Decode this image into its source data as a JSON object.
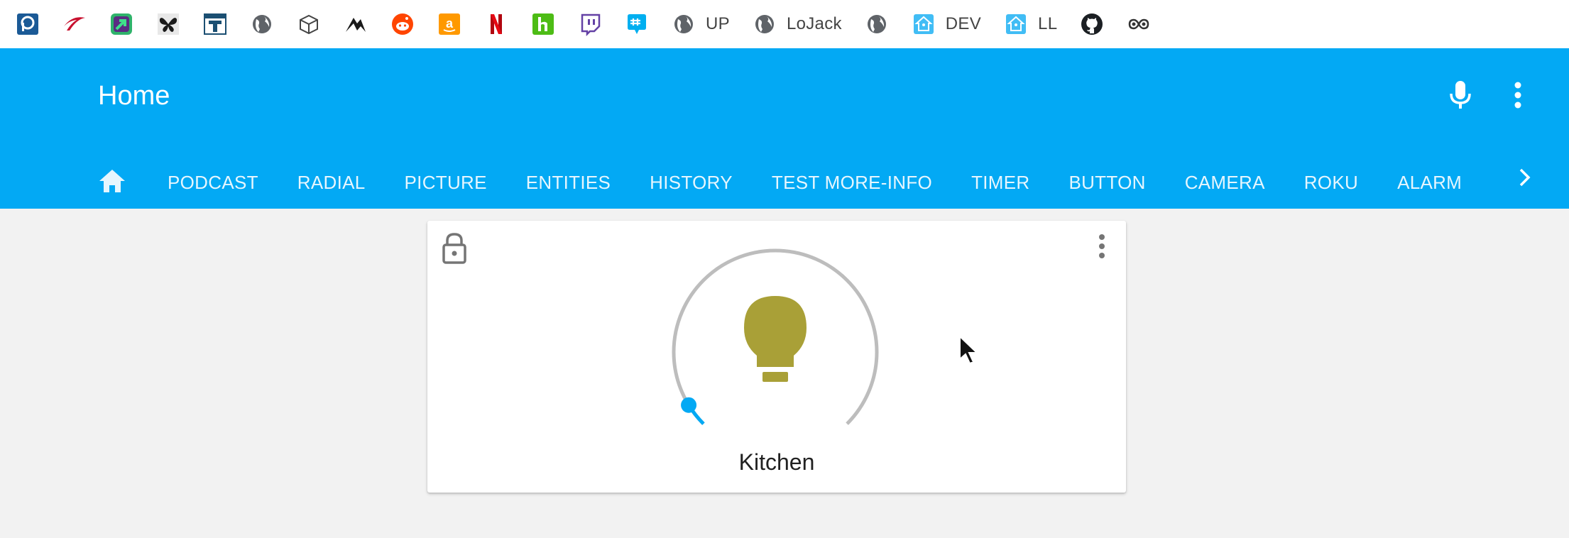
{
  "bookmarks": [
    {
      "icon": "pocket-casts-icon",
      "label": ""
    },
    {
      "icon": "capital-one-icon",
      "label": ""
    },
    {
      "icon": "green-arrow-app-icon",
      "label": ""
    },
    {
      "icon": "butterfly-icon",
      "label": ""
    },
    {
      "icon": "t-logo-icon",
      "label": ""
    },
    {
      "icon": "globe-icon",
      "label": ""
    },
    {
      "icon": "package-box-icon",
      "label": ""
    },
    {
      "icon": "bird-logo-icon",
      "label": ""
    },
    {
      "icon": "reddit-icon",
      "label": ""
    },
    {
      "icon": "amazon-icon",
      "label": ""
    },
    {
      "icon": "netflix-icon",
      "label": ""
    },
    {
      "icon": "houzz-icon",
      "label": ""
    },
    {
      "icon": "twitch-icon",
      "label": ""
    },
    {
      "icon": "groupme-icon",
      "label": ""
    },
    {
      "icon": "globe-icon",
      "label": "UP"
    },
    {
      "icon": "globe-icon",
      "label": "LoJack"
    },
    {
      "icon": "globe-icon",
      "label": ""
    },
    {
      "icon": "home-assistant-icon",
      "label": "DEV"
    },
    {
      "icon": "home-assistant-icon",
      "label": "LL"
    },
    {
      "icon": "github-icon",
      "label": ""
    },
    {
      "icon": "infinity-icon",
      "label": ""
    }
  ],
  "header": {
    "title": "Home",
    "tabs": [
      "PODCAST",
      "RADIAL",
      "PICTURE",
      "ENTITIES",
      "HISTORY",
      "TEST MORE-INFO",
      "TIMER",
      "BUTTON",
      "CAMERA",
      "ROKU",
      "ALARM"
    ]
  },
  "card": {
    "entity_name": "Kitchen",
    "brightness_fraction": 0.05,
    "light_color": "#a9a037"
  },
  "colors": {
    "primary": "#03a9f4",
    "slider_track": "#bdbdbd"
  }
}
